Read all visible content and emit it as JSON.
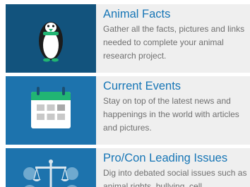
{
  "cards": [
    {
      "title": "Animal Facts",
      "description": "Gather all the facts, pictures and links needed to complete your animal research project.",
      "icon": "penguin-icon"
    },
    {
      "title": "Current Events",
      "description": "Stay on top of the latest news and happenings in the world with articles and pictures.",
      "icon": "calendar-icon"
    },
    {
      "title": "Pro/Con Leading Issues",
      "description": "Dig into debated social issues such as animal rights, bullying, cell",
      "icon": "scales-icon"
    }
  ],
  "colors": {
    "title": "#1776b6",
    "text": "#707070",
    "card_bg": "#efefef",
    "thumb_dark": "#12537d",
    "thumb_light": "#1d73ad",
    "accent_green": "#21b573"
  }
}
